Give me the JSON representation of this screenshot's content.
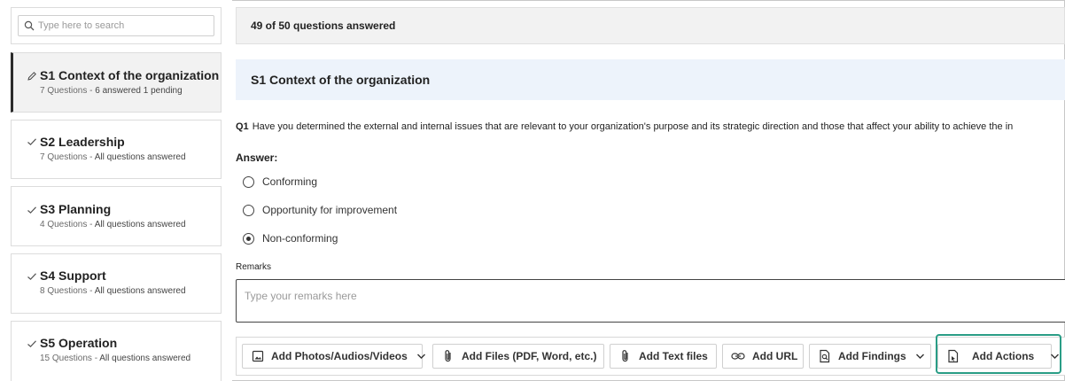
{
  "search": {
    "placeholder": "Type here to search"
  },
  "sidebar": {
    "sections": [
      {
        "code": "S1",
        "title": "S1 Context of the organization",
        "count": "7 Questions - ",
        "status": "6 answered 1 pending",
        "active": true
      },
      {
        "code": "S2",
        "title": "S2 Leadership",
        "count": "7 Questions - ",
        "status": "All questions answered",
        "active": false
      },
      {
        "code": "S3",
        "title": "S3 Planning",
        "count": "4 Questions - ",
        "status": "All questions answered",
        "active": false
      },
      {
        "code": "S4",
        "title": "S4 Support",
        "count": "8 Questions - ",
        "status": "All questions answered",
        "active": false
      },
      {
        "code": "S5",
        "title": "S5 Operation",
        "count": "15 Questions - ",
        "status": "All questions answered",
        "active": false
      }
    ]
  },
  "progress": {
    "text": "49 of 50 questions answered",
    "answered": 49,
    "total": 50
  },
  "section_header": "S1 Context of the organization",
  "question": {
    "number": "Q1",
    "text": "Have you determined the external and internal issues that are relevant to your organization's purpose and its strategic direction and those that affect your ability to achieve the in"
  },
  "answer": {
    "label": "Answer:",
    "options": [
      {
        "label": "Conforming",
        "selected": false
      },
      {
        "label": "Opportunity for improvement",
        "selected": false
      },
      {
        "label": "Non-conforming",
        "selected": true
      }
    ]
  },
  "remarks": {
    "label": "Remarks",
    "placeholder": "Type your remarks here"
  },
  "toolbar": {
    "add_media": "Add Photos/Audios/Videos",
    "add_files": "Add Files (PDF, Word, etc.)",
    "add_text_files": "Add Text files",
    "add_url": "Add URL",
    "add_findings": "Add Findings",
    "add_actions": "Add Actions"
  },
  "colors": {
    "accent_highlight": "#2a9d86",
    "section_header_bg": "#edf3fb",
    "progress_bg": "#f2f2f2"
  }
}
